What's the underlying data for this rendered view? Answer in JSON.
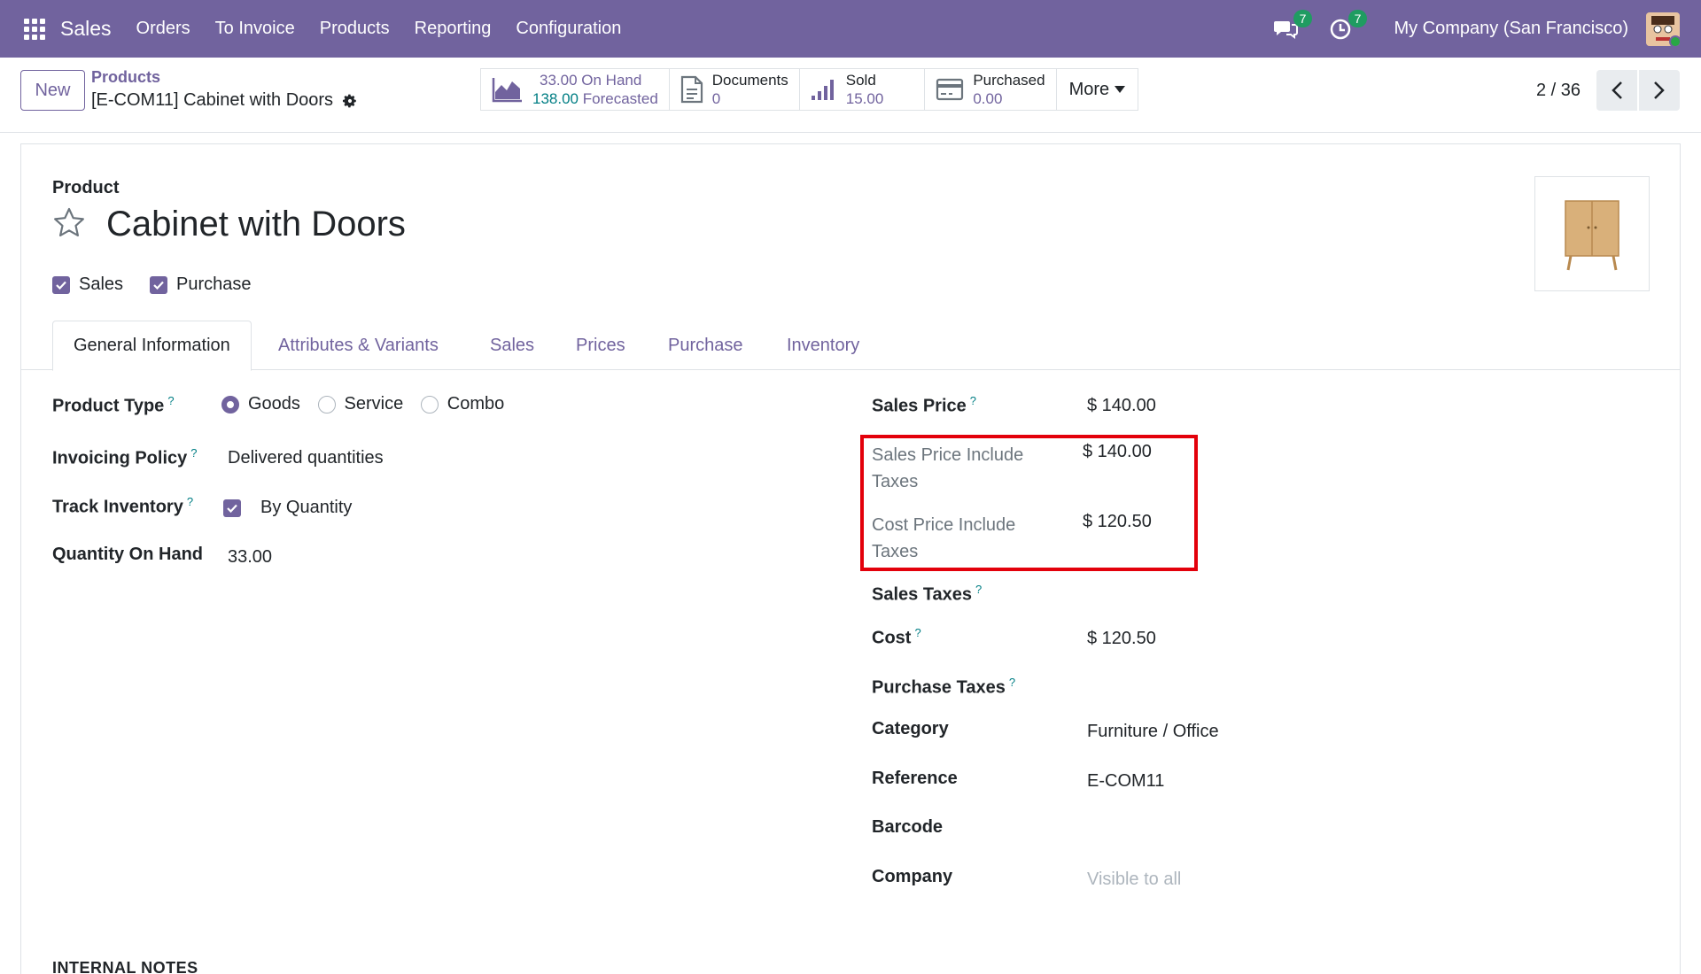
{
  "navbar": {
    "app_name": "Sales",
    "menu": [
      "Orders",
      "To Invoice",
      "Products",
      "Reporting",
      "Configuration"
    ],
    "messages_badge": "7",
    "activities_badge": "7",
    "company": "My Company (San Francisco)"
  },
  "control": {
    "new_label": "New",
    "breadcrumb_parent": "Products",
    "breadcrumb_current": "[E-COM11] Cabinet with Doors",
    "stats": {
      "on_hand_value": "33.00",
      "on_hand_label": "On Hand",
      "forecast_value": "138.00",
      "forecast_label": "Forecasted",
      "documents_label": "Documents",
      "documents_value": "0",
      "sold_label": "Sold",
      "sold_value": "15.00",
      "purchased_label": "Purchased",
      "purchased_value": "0.00",
      "more_label": "More"
    },
    "pager": "2 / 36"
  },
  "form": {
    "top_label": "Product",
    "product_name": "Cabinet with Doors",
    "checks": [
      "Sales",
      "Purchase"
    ],
    "tabs": [
      "General Information",
      "Attributes & Variants",
      "Sales",
      "Prices",
      "Purchase",
      "Inventory"
    ],
    "left": {
      "product_type_label": "Product Type",
      "product_type_options": [
        "Goods",
        "Service",
        "Combo"
      ],
      "invoicing_policy_label": "Invoicing Policy",
      "invoicing_policy_value": "Delivered quantities",
      "track_inventory_label": "Track Inventory",
      "track_inventory_value": "By Quantity",
      "qty_on_hand_label": "Quantity On Hand",
      "qty_on_hand_value": "33.00"
    },
    "right": {
      "sales_price_label": "Sales Price",
      "sales_price_value": "$ 140.00",
      "sales_price_incl_label_1": "Sales Price Include",
      "sales_price_incl_label_2": "Taxes",
      "sales_price_incl_value": "$ 140.00",
      "cost_price_incl_label_1": "Cost Price Include",
      "cost_price_incl_label_2": "Taxes",
      "cost_price_incl_value": "$ 120.50",
      "sales_taxes_label": "Sales Taxes",
      "cost_label": "Cost",
      "cost_value": "$ 120.50",
      "purchase_taxes_label": "Purchase Taxes",
      "category_label": "Category",
      "category_value": "Furniture / Office",
      "reference_label": "Reference",
      "reference_value": "E-COM11",
      "barcode_label": "Barcode",
      "company_label": "Company",
      "company_placeholder": "Visible to all"
    },
    "internal_notes_label": "INTERNAL NOTES"
  },
  "colors": {
    "brand": "#71639e",
    "highlight": "#e3000b",
    "teal": "#017e84"
  }
}
